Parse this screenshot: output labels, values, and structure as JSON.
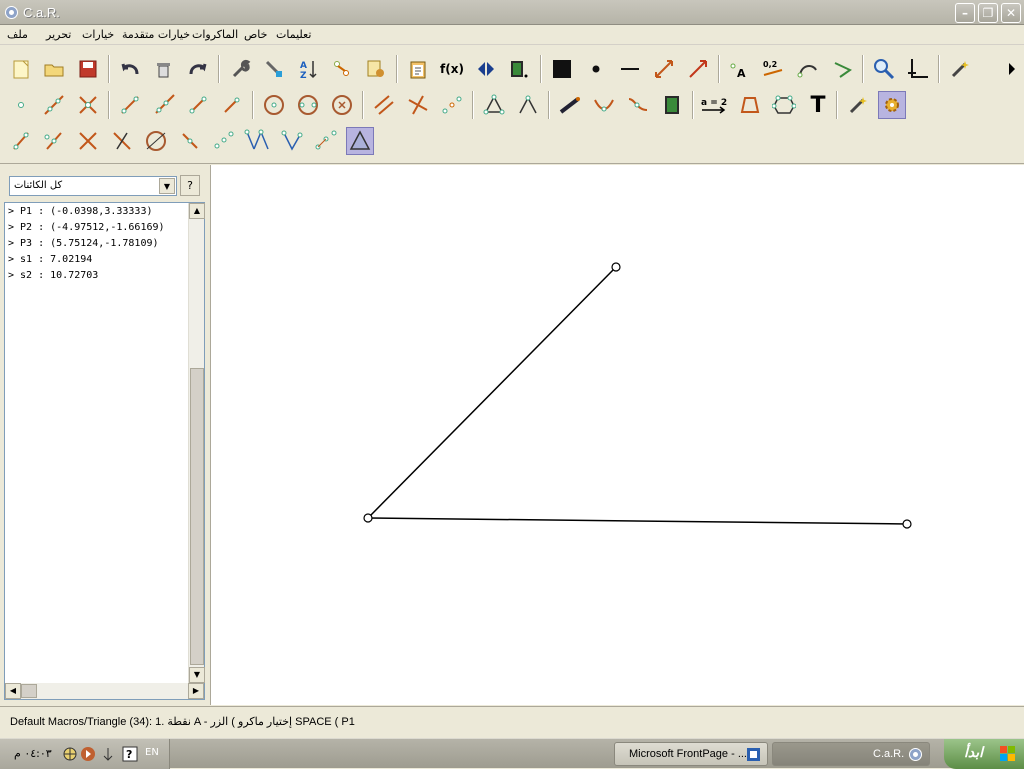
{
  "window": {
    "title": "C.a.R.",
    "minimize": "–",
    "restore": "❐",
    "close": "✕"
  },
  "menu": {
    "items": [
      "ملف",
      "تحرير",
      "خيارات",
      "خيارات متقدمة",
      "الماكروات",
      "خاص",
      "تعليمات"
    ]
  },
  "toolbar": {
    "fx_label": "f(x)",
    "num_label": "0,2",
    "a_label": "A",
    "eq_label": "a = 2",
    "text_label": "T"
  },
  "objects_panel": {
    "filter_value": "كل الكائنات",
    "help_label": "?",
    "rows": [
      "> P1 : (-0.0398,3.33333)",
      "> P2 : (-4.97512,-1.66169)",
      "> P3 : (5.75124,-1.78109)",
      "> s1 : 7.02194",
      "> s2 : 10.72703"
    ]
  },
  "status": {
    "text": "Default Macros/Triangle (34): 1. نقطة A  - إختيار  ماكرو )  الزر SPACE ( P1"
  },
  "taskbar": {
    "clock": "٠٤:٠٣ م",
    "language": "EN",
    "tasks": [
      {
        "label": "Microsoft FrontPage - ..."
      },
      {
        "label": "C.a.R."
      }
    ],
    "start_label": "ابدأ"
  },
  "colors": {
    "accent_selected": "#b8b4e0",
    "canvas_bg": "#ffffff",
    "window_face": "#ece9d8"
  }
}
